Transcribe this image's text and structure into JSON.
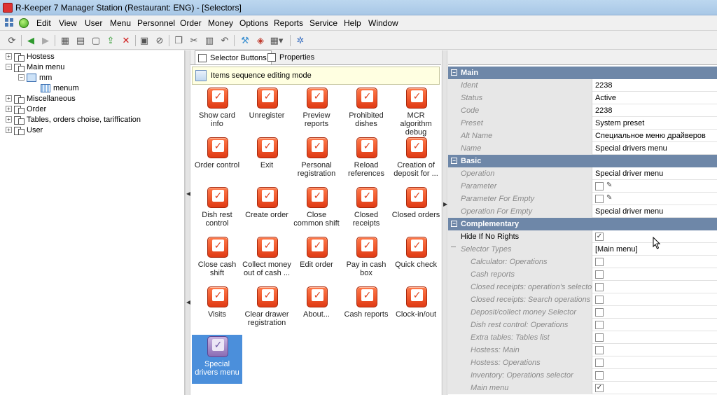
{
  "window": {
    "title": "R-Keeper 7 Manager Station (Restaurant: ENG) - [Selectors]"
  },
  "menubar": {
    "items": [
      "Edit",
      "View",
      "User",
      "Menu",
      "Personnel",
      "Order",
      "Money",
      "Options",
      "Reports",
      "Service",
      "Help",
      "Window"
    ]
  },
  "toolbar": {
    "icons": [
      "refresh-icon",
      "back-icon",
      "forward-icon",
      "grid-icon",
      "document-icon",
      "new-icon",
      "export-icon",
      "delete-icon",
      "save-icon",
      "cancel-icon",
      "copy-icon",
      "cut-icon",
      "paste-icon",
      "undo-icon",
      "tool-icon",
      "layout-icon",
      "settings-icon"
    ]
  },
  "tree": {
    "items": [
      {
        "label": "Hostess",
        "expander": "+"
      },
      {
        "label": "Main menu",
        "expander": "−"
      },
      {
        "label": "mm",
        "expander": "−"
      },
      {
        "label": "menum",
        "expander": ""
      },
      {
        "label": "Miscellaneous",
        "expander": "+"
      },
      {
        "label": "Order",
        "expander": "+"
      },
      {
        "label": "Tables, orders choise, tariffication",
        "expander": "+"
      },
      {
        "label": "User",
        "expander": "+"
      }
    ]
  },
  "tabs": [
    {
      "label": "Selector Buttons"
    },
    {
      "label": "Properties"
    }
  ],
  "mode_banner": {
    "text": "Items sequence editing mode"
  },
  "buttons": [
    "Show card info",
    "Unregister",
    "Preview reports",
    "Prohibited dishes",
    "MCR algorithm debug",
    "Order control",
    "Exit",
    "Personal registration",
    "Reload references",
    "Creation of deposit for ...",
    "Dish rest control",
    "Create order",
    "Close common shift",
    "Closed receipts",
    "Closed orders",
    "Close cash shift",
    "Collect money out of cash ...",
    "Edit order",
    "Pay in cash box",
    "Quick check",
    "Visits",
    "Clear drawer registration",
    "About...",
    "Cash reports",
    "Clock-in/out",
    "Special drivers menu"
  ],
  "properties": {
    "main": {
      "title": "Main",
      "rows": [
        {
          "name": "Ident",
          "value": "2238"
        },
        {
          "name": "Status",
          "value": "Active"
        },
        {
          "name": "Code",
          "value": "2238"
        },
        {
          "name": "Preset",
          "value": "System preset"
        },
        {
          "name": "Alt Name",
          "value": "Специальное меню драйверов"
        },
        {
          "name": "Name",
          "value": "Special drivers menu"
        }
      ]
    },
    "basic": {
      "title": "Basic",
      "rows": [
        {
          "name": "Operation",
          "value": "Special driver menu"
        },
        {
          "name": "Parameter",
          "value": ""
        },
        {
          "name": "Parameter For Empty",
          "value": ""
        },
        {
          "name": "Operation For Empty",
          "value": "Special driver menu"
        }
      ]
    },
    "complementary": {
      "title": "Complementary",
      "hide_if_no_rights": {
        "name": "Hide If No Rights",
        "checked": "✓"
      },
      "selector_types": {
        "name": "Selector Types",
        "value": "[Main menu]"
      },
      "types": [
        {
          "name": "Calculator: Operations",
          "checked": ""
        },
        {
          "name": "Cash reports",
          "checked": ""
        },
        {
          "name": "Closed receipts: operation's selector",
          "checked": ""
        },
        {
          "name": "Closed receipts: Search operations",
          "checked": ""
        },
        {
          "name": "Deposit/collect money Selector",
          "checked": ""
        },
        {
          "name": "Dish rest control: Operations",
          "checked": ""
        },
        {
          "name": "Extra tables: Tables list",
          "checked": ""
        },
        {
          "name": "Hostess: Main",
          "checked": ""
        },
        {
          "name": "Hostess: Operations",
          "checked": ""
        },
        {
          "name": "Inventory: Operations selector",
          "checked": ""
        },
        {
          "name": "Main menu",
          "checked": "✓"
        }
      ]
    }
  }
}
